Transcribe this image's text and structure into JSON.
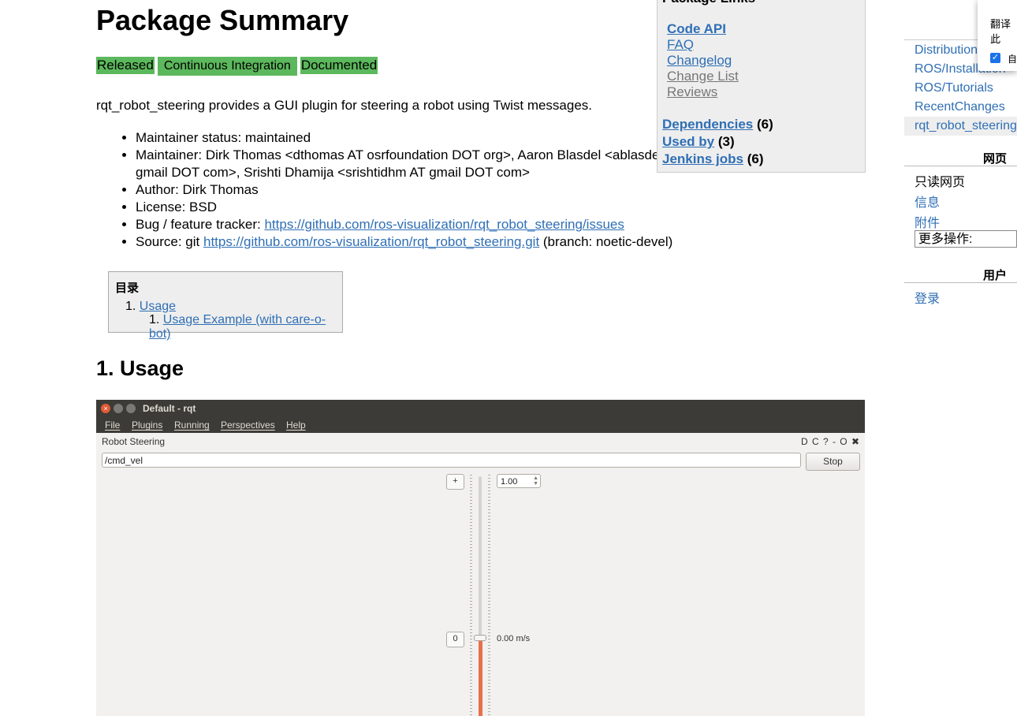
{
  "main": {
    "title": "Package Summary",
    "badges": [
      "Released",
      "Continuous Integration",
      "Documented"
    ],
    "description": "rqt_robot_steering provides a GUI plugin for steering a robot using Twist messages.",
    "info": {
      "maintainer_status": "Maintainer status: maintained",
      "maintainer": "Maintainer: Dirk Thomas <dthomas AT osrfoundation DOT org>, Aaron Blasdel <ablasdel AT gmail DOT com>, Srishti Dhamija <srishtidhm AT gmail DOT com>",
      "author": "Author: Dirk Thomas",
      "license": "License: BSD",
      "bug_prefix": "Bug / feature tracker: ",
      "bug_url": "https://github.com/ros-visualization/rqt_robot_steering/issues",
      "source_prefix": "Source: git ",
      "source_url": "https://github.com/ros-visualization/rqt_robot_steering.git",
      "source_suffix": " (branch: noetic-devel)"
    },
    "toc": {
      "title": "目录",
      "items": [
        {
          "num": "1.",
          "label": "Usage"
        },
        {
          "num": "1.",
          "label": "Usage Example (with care-o-bot)"
        }
      ]
    },
    "usage_heading": "1. Usage"
  },
  "package_links": {
    "title": "Package Links",
    "links": [
      "Code API",
      "FAQ",
      "Changelog",
      "Change List",
      "Reviews"
    ],
    "counts": [
      {
        "label": "Dependencies",
        "count": "(6)"
      },
      {
        "label": "Used by",
        "count": "(3)"
      },
      {
        "label": "Jenkins jobs",
        "count": "(6)"
      }
    ]
  },
  "sidebar": {
    "links": [
      "Distributions",
      "ROS/Installation",
      "ROS/Tutorials",
      "RecentChanges",
      "rqt_robot_steering"
    ],
    "page_heading": "网页",
    "page_items": [
      "只读网页",
      "信息",
      "附件"
    ],
    "more_actions": "更多操作:",
    "user_heading": "用户",
    "login": "登录"
  },
  "translate_popup": {
    "text": "翻译此",
    "checkbox_label": "自"
  },
  "rqt": {
    "window_title": "Default - rqt",
    "menus": [
      "File",
      "Plugins",
      "Running",
      "Perspectives",
      "Help"
    ],
    "panel_title": "Robot Steering",
    "panel_controls": "D C ? - O ✖",
    "topic": "/cmd_vel",
    "stop": "Stop",
    "plus": "+",
    "zero": "0",
    "max_value": "1.00",
    "speed": "0.00 m/s"
  }
}
